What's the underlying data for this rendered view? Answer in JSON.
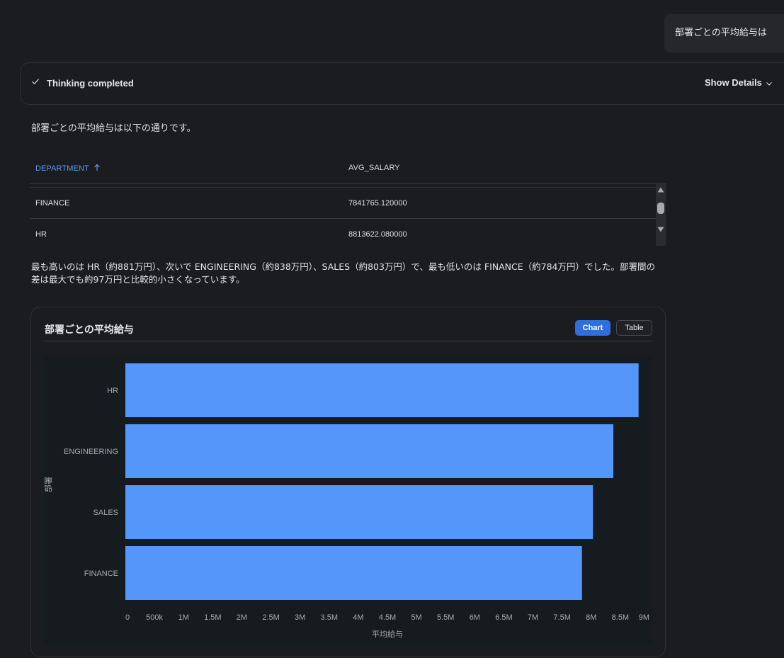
{
  "user_message": "部署ごとの平均給与は",
  "thinking": {
    "status": "Thinking completed",
    "details_label": "Show Details"
  },
  "intro_text": "部署ごとの平均給与は以下の通りです。",
  "table": {
    "columns": [
      "DEPARTMENT",
      "AVG_SALARY"
    ],
    "rows": [
      [
        "FINANCE",
        "7841765.120000"
      ],
      [
        "HR",
        "8813622.080000"
      ]
    ]
  },
  "summary_text": "最も高いのは HR（約881万円）、次いで ENGINEERING（約838万円）、SALES（約803万円）で、最も低いのは FINANCE（約784万円）でした。部署間の差は最大でも約97万円と比較的小さくなっています。",
  "chart_card": {
    "title": "部署ごとの平均給与",
    "chart_button": "Chart",
    "table_button": "Table"
  },
  "colors": {
    "accent": "#2f6fdb",
    "bar": "#5596fb",
    "sort_header": "#5b9cf5",
    "plot_bg": "#161b1f"
  },
  "chart_data": {
    "type": "bar",
    "orientation": "horizontal",
    "categories": [
      "HR",
      "ENGINEERING",
      "SALES",
      "FINANCE"
    ],
    "values": [
      8813622.08,
      8380000,
      8030000,
      7841765.12
    ],
    "xlabel": "平均給与",
    "ylabel": "部署",
    "xlim": [
      0,
      9000000
    ],
    "xticks": [
      0,
      500000,
      1000000,
      1500000,
      2000000,
      2500000,
      3000000,
      3500000,
      4000000,
      4500000,
      5000000,
      5500000,
      6000000,
      6500000,
      7000000,
      7500000,
      8000000,
      8500000,
      9000000
    ],
    "xtick_labels": [
      "0",
      "500k",
      "1M",
      "1.5M",
      "2M",
      "2.5M",
      "3M",
      "3.5M",
      "4M",
      "4.5M",
      "5M",
      "5.5M",
      "6M",
      "6.5M",
      "7M",
      "7.5M",
      "8M",
      "8.5M",
      "9M"
    ],
    "grid": false,
    "legend": "none"
  }
}
